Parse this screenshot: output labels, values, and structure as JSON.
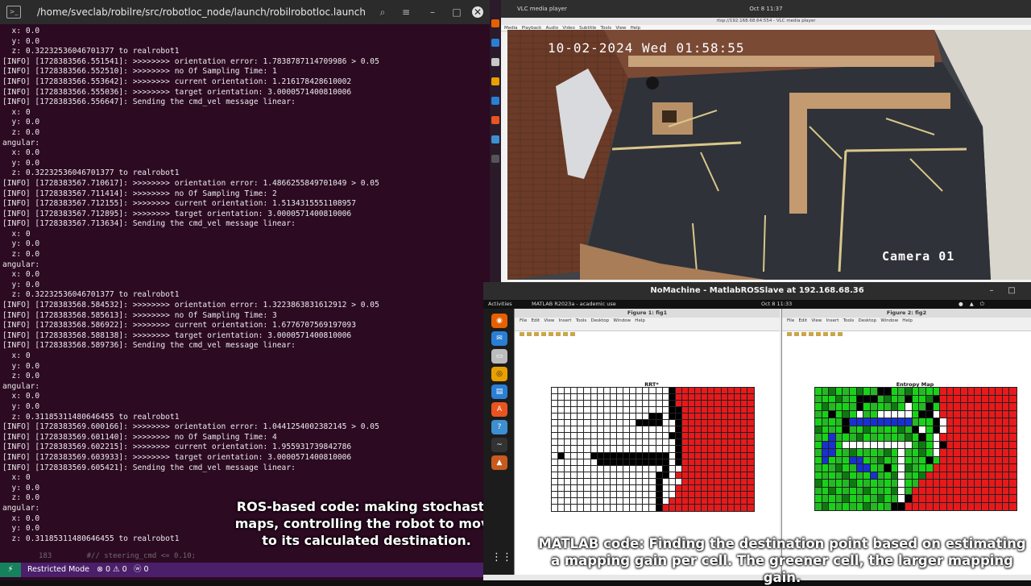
{
  "terminal": {
    "title": "/home/sveclab/robilre/src/robotloc_node/launch/robilrobotloc.launch http://1...",
    "lines": [
      "  x: 0.0",
      "  y: 0.0",
      "  z: 0.32232536046701377 to realrobot1",
      "[INFO] [1728383566.551541]: >>>>>>>> orientation error: 1.7838787114709986 > 0.05",
      "[INFO] [1728383566.552510]: >>>>>>>> no Of Sampling Time: 1",
      "[INFO] [1728383566.553642]: >>>>>>>> current orientation: 1.216178428610002",
      "[INFO] [1728383566.555036]: >>>>>>>> target orientation: 3.0000571400810006",
      "[INFO] [1728383566.556647]: Sending the cmd_vel message linear:",
      "  x: 0",
      "  y: 0.0",
      "  z: 0.0",
      "angular:",
      "  x: 0.0",
      "  y: 0.0",
      "  z: 0.32232536046701377 to realrobot1",
      "[INFO] [1728383567.710617]: >>>>>>>> orientation error: 1.4866255849701049 > 0.05",
      "[INFO] [1728383567.711414]: >>>>>>>> no Of Sampling Time: 2",
      "[INFO] [1728383567.712155]: >>>>>>>> current orientation: 1.5134315551108957",
      "[INFO] [1728383567.712895]: >>>>>>>> target orientation: 3.0000571400810006",
      "[INFO] [1728383567.713634]: Sending the cmd_vel message linear:",
      "  x: 0",
      "  y: 0.0",
      "  z: 0.0",
      "angular:",
      "  x: 0.0",
      "  y: 0.0",
      "  z: 0.32232536046701377 to realrobot1",
      "[INFO] [1728383568.584532]: >>>>>>>> orientation error: 1.3223863831612912 > 0.05",
      "[INFO] [1728383568.585613]: >>>>>>>> no Of Sampling Time: 3",
      "[INFO] [1728383568.586922]: >>>>>>>> current orientation: 1.6776707569197093",
      "[INFO] [1728383568.588138]: >>>>>>>> target orientation: 3.0000571400810006",
      "[INFO] [1728383568.589736]: Sending the cmd_vel message linear:",
      "  x: 0",
      "  y: 0.0",
      "  z: 0.0",
      "angular:",
      "  x: 0.0",
      "  y: 0.0",
      "  z: 0.31185311480646455 to realrobot1",
      "[INFO] [1728383569.600166]: >>>>>>>> orientation error: 1.0441254002382145 > 0.05",
      "[INFO] [1728383569.601140]: >>>>>>>> no Of Sampling Time: 4",
      "[INFO] [1728383569.602215]: >>>>>>>> current orientation: 1.955931739842786",
      "[INFO] [1728383569.603933]: >>>>>>>> target orientation: 3.0000571400810006",
      "[INFO] [1728383569.605421]: Sending the cmd_vel message linear:",
      "  x: 0",
      "  y: 0.0",
      "  z: 0.0",
      "angular:",
      "  x: 0.0",
      "  y: 0.0",
      "  z: 0.31185311480646455 to realrobot1"
    ],
    "editor_peek": "183        #// steering_cmd <= 0.10;"
  },
  "vscode_status": {
    "remote": "⚡",
    "restricted": "Restricted Mode",
    "problems": "⊗ 0 ⚠ 0",
    "ports": "ⓦ 0"
  },
  "caption_left": "ROS-based code: making stochastic maps, controlling the robot to move to its calculated destination.",
  "vlc": {
    "window_title": "VLC media player",
    "clock": "Oct 8  11:37",
    "address": "rtsp://192.168.68.64:554 - VLC media player",
    "menu": "Media   Playback   Audio   Video   Subtitle   Tools   View   Help",
    "timestamp": "10-02-2024 Wed 01:58:55",
    "camera_label": "Camera 01"
  },
  "nomachine": {
    "title": "NoMachine - MatlabROSSlave at 192.168.68.36",
    "activities": "Activities",
    "app_label": "MATLAB R2023a - academic use",
    "clock": "Oct 8  11:33",
    "tray": "● ▲ ⏻"
  },
  "figures": [
    {
      "title": "Figure 1: fig1",
      "plot_title": "RRT*",
      "menu": "File   Edit   View   Insert   Tools   Desktop   Window   Help"
    },
    {
      "title": "Figure 2: fig2",
      "plot_title": "Entropy Map",
      "menu": "File   Edit   View   Insert   Tools   Desktop   Window   Help"
    }
  ],
  "grids": {
    "rrt": [
      "WWWWWWWWWWWWWWWWWWBRRRRRRRRRRRR",
      "WWWWWWWWWWWWWWWWWWBRRRRRRRRRRRR",
      "WWWWWWWWWWWWWWWWWWBRRRRRRRRRRRR",
      "WWWWWWWWWWWWWWWWWWBBRRRRRRRRRRR",
      "WWWWWWWWWWWWWWWBBWBBRRRRRRRRRRR",
      "WWWWWWWWWWWWWBBBBWWBRRRRRRRRRRR",
      "WWWWWWWWWWWWWWWWWWWBRRRRRRRRRRR",
      "WWWWWWWWWWWWWWWWWWBBRRRRRRRRRRR",
      "WWWWWWWWWWWWWWWWWWWBRRRRRRRRRRR",
      "WWWWWWWWWWWWWWWWWWWBRRRRRRRRRRR",
      "WBWWWWBBBBBBBBBBBBWBRRRRRRRRRRR",
      "WWWWWWWBBBBBBBBBBBWBRRRRRRRRRRR",
      "WWWWWWWWWWWWWWWWWBWWRRRRRRRRRRR",
      "WWWWWWWWWWWWWWWWBBWRRRRRRRRRRRR",
      "WWWWWWWWWWWWWWWWBWWWRRRRRRRRRRR",
      "WWWWWWWWWWWWWWWWBWWRRRRRRRRRRRR",
      "WWWWWWWWWWWWWWWWBWWRRRRRRRRRRRR",
      "WWWWWWWWWWWWWWWWBWRRRRRRRRRRRRR",
      "WWWWWWWWWWWWWWWWBRRRRRRRRRRRRRR"
    ],
    "entropy": [
      "GgDGgGDGgBBGgDGgGGRRRRRRRRRRR",
      "gGGDgGBBBgDGgBGGDBRRRRRRRRRRR",
      "GDgGGgBGgGgDGWGgBGRRRRRRRRRRR",
      "gGBGDGWgGWWWWWGBBWRRRRRRRRRRR",
      "GgGgBNNNNNNNNNgGGBWRRRRRRRRRR",
      "DGgGBgGDGgGGDgBWGBWRRRRRRRRRR",
      "gGNgGgDGgGgGgDGBGWRRRRRRRRRRR",
      "GNNGWWWWWWWWWWgDGWBRRRRRRRRRR",
      "gNNGgDGgGgDGWgGDGWRRRRRRRRRRR",
      "GNGgGNNGgDGgWGgGBGRRRRRRRRRRR",
      "gGgDGgNNGgBGWDgGGRRRRRRRRRRRR",
      "GgGgDGgGNgGDWgGDRRRRRRRRRRRRR",
      "DGgGgDGgGgGgWGgRRRRRRRRRRRRRR",
      "gGDGgGgDGgGDWgRRRRRRRRRRRRRRR",
      "GgGgDGgGgDGgWBRRRRRRRRRRRRRRR",
      "gDGgGgGDgGgBBRRRRRRRRRRRRRRRR"
    ]
  },
  "caption_right": "MATLAB code: Finding the destination point based on estimating a mapping gain per cell. The greener cell, the larger mapping gain.",
  "colors": {
    "terminal_bg": "#2c0a22",
    "red_cell": "#e8191b",
    "green_cell": "#17d317",
    "dark_green_cell": "#0d7a10",
    "navy_cell": "#1830d0"
  },
  "icons": [
    "terminal-icon",
    "search-icon",
    "hamburger-icon",
    "minimize-icon",
    "maximize-icon",
    "close-icon",
    "firefox-icon",
    "thunderbird-icon",
    "files-icon",
    "rhythmbox-icon",
    "writer-icon",
    "appstore-icon",
    "help-icon",
    "terminal-dock-icon",
    "matlab-icon",
    "apps-grid-icon"
  ]
}
